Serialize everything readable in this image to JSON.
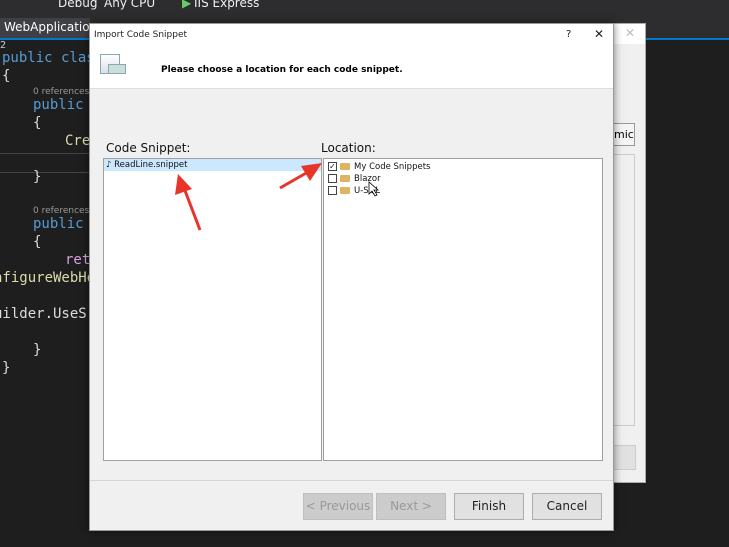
{
  "toolbar": {
    "config": "Debug",
    "platform": "Any CPU",
    "run": "IIS Express"
  },
  "editor": {
    "tab": "WebApplication1",
    "line_marker": "2",
    "lines": [
      "public class",
      "{",
      "public",
      "{",
      "Cre",
      "}",
      "public",
      "{",
      "ret",
      "nfigureWebHo",
      "uilder.UseS",
      "}",
      "}"
    ],
    "references": "0 references"
  },
  "background_dialog": {
    "button_fragment": "micr"
  },
  "dialog": {
    "title": "Import Code Snippet",
    "help": "?",
    "instruction": "Please choose a location for each code snippet.",
    "code_snippet_label": "Code Snippet:",
    "location_label": "Location:",
    "snippets": [
      {
        "name": "ReadLine.snippet",
        "selected": true
      }
    ],
    "locations": [
      {
        "name": "My Code Snippets",
        "checked": true
      },
      {
        "name": "Blazor",
        "checked": false
      },
      {
        "name": "U-SQL",
        "checked": false
      }
    ],
    "buttons": {
      "previous": "< Previous",
      "next": "Next >",
      "finish": "Finish",
      "cancel": "Cancel"
    }
  },
  "colors": {
    "annotation_arrow": "#e8352a",
    "selection": "#cce8ff"
  }
}
